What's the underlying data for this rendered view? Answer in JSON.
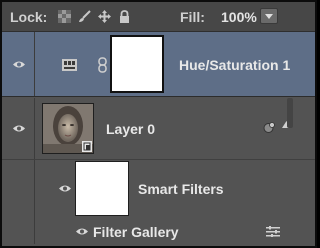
{
  "toolbar": {
    "lock_label": "Lock:",
    "fill_label": "Fill:",
    "fill_value": "100%",
    "icons": [
      "lock-transparent-pixels-icon",
      "lock-image-pixels-icon",
      "lock-position-icon",
      "lock-all-icon"
    ]
  },
  "layers": {
    "hue": {
      "name": "Hue/Saturation 1"
    },
    "layer0": {
      "name": "Layer 0"
    },
    "smart_filters": {
      "name": "Smart Filters"
    },
    "filter_gallery": {
      "name": "Filter Gallery"
    }
  },
  "colors": {
    "panel_bg": "#535353",
    "selected_row": "#5e6e87",
    "toolbar_bg": "#474747",
    "text": "#e8e8e8"
  }
}
